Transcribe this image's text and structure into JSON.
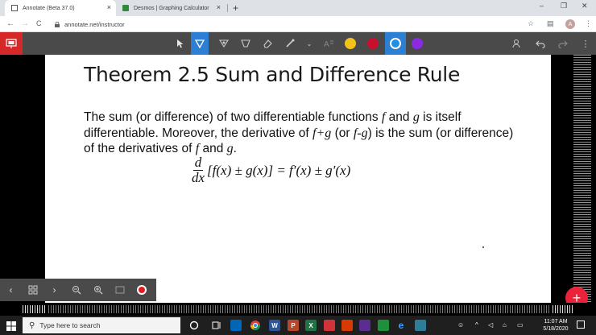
{
  "browser": {
    "tabs": [
      {
        "label": "Annotate (Beta 37.0)",
        "close": "×"
      },
      {
        "label": "Desmos | Graphing Calculator",
        "close": "×"
      }
    ],
    "new_tab": "+",
    "window_controls": {
      "minimize": "–",
      "restore": "❐",
      "close": "✕"
    },
    "nav": {
      "back": "←",
      "forward": "→",
      "reload": "C"
    },
    "url": "annotate.net/instructor",
    "avatar_letter": "A",
    "menu": "⋮"
  },
  "toolbar": {
    "colors": {
      "yellow": "#f3c21a",
      "red": "#c8102e",
      "blue": "#1e8fe1",
      "purple": "#8a2be2",
      "accent": "#2c7fd3"
    }
  },
  "slide": {
    "title": "Theorem 2.5 Sum and Difference Rule",
    "line1_pre": "The sum (or difference) of two differentiable functions ",
    "f": "f",
    "line1_and": " and ",
    "g": "g",
    "line1_post": " is itself differentiable. Moreover, the derivative of ",
    "fpg": "f+g",
    "or_open": " (or ",
    "fmg": "f-g",
    "line2_post": ") is the sum (or difference) of the derivatives of ",
    "f2": "f",
    "and2": " and ",
    "g2": "g",
    "period": ".",
    "formula": {
      "num": "d",
      "den": "dx",
      "rhs": "[f(x) ± g(x)] = f′(x) ± g′(x)"
    }
  },
  "fab_label": "+",
  "taskbar": {
    "search_placeholder": "Type here to search",
    "time": "11:07 AM",
    "date": "5/18/2020"
  }
}
